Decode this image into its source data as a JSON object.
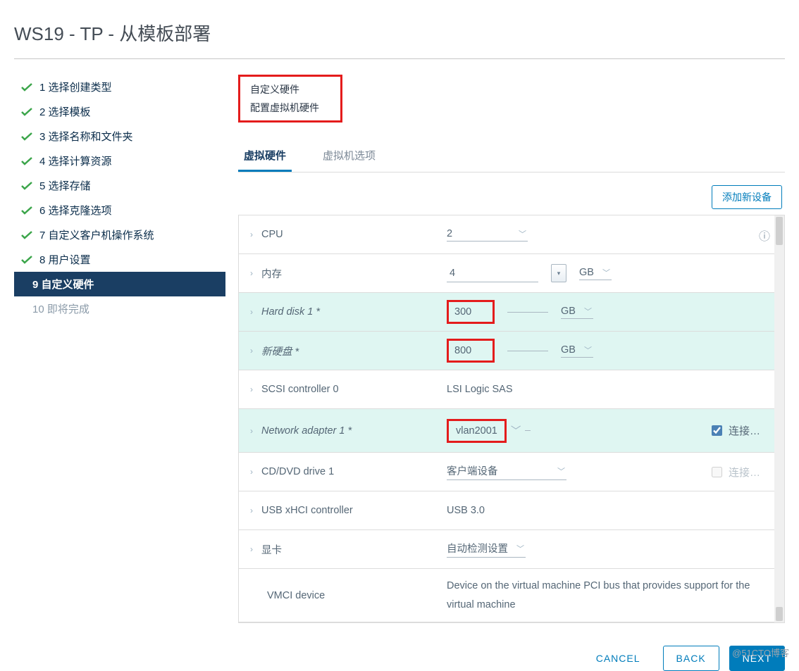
{
  "title": "WS19 - TP - 从模板部署",
  "sidebar": {
    "steps": [
      {
        "label": "1 选择创建类型"
      },
      {
        "label": "2 选择模板"
      },
      {
        "label": "3 选择名称和文件夹"
      },
      {
        "label": "4 选择计算资源"
      },
      {
        "label": "5 选择存储"
      },
      {
        "label": "6 选择克隆选项"
      },
      {
        "label": "7 自定义客户机操作系统"
      },
      {
        "label": "8 用户设置"
      }
    ],
    "active": "9 自定义硬件",
    "disabled": "10 即将完成"
  },
  "header": {
    "title": "自定义硬件",
    "subtitle": "配置虚拟机硬件"
  },
  "tabs": {
    "active": "虚拟硬件",
    "other": "虚拟机选项"
  },
  "add_device": "添加新设备",
  "hw": {
    "cpu": {
      "label": "CPU",
      "value": "2"
    },
    "mem": {
      "label": "内存",
      "value": "4",
      "unit": "GB"
    },
    "hd1": {
      "label": "Hard disk 1 *",
      "value": "300",
      "unit": "GB"
    },
    "hd2": {
      "label": "新硬盘 *",
      "value": "800",
      "unit": "GB"
    },
    "scsi": {
      "label": "SCSI controller 0",
      "value": "LSI Logic SAS"
    },
    "net": {
      "label": "Network adapter 1 *",
      "value": "vlan2001",
      "connect": "连接…"
    },
    "cd": {
      "label": "CD/DVD drive 1",
      "value": "客户端设备",
      "connect": "连接…"
    },
    "usb": {
      "label": "USB xHCI controller",
      "value": "USB 3.0"
    },
    "gpu": {
      "label": "显卡",
      "value": "自动检测设置"
    },
    "vmci": {
      "label": "VMCI device",
      "value": "Device on the virtual machine PCI bus that provides support for the virtual machine"
    }
  },
  "footer": {
    "cancel": "CANCEL",
    "back": "BACK",
    "next": "NEXT"
  },
  "watermark": "@51CTO博客"
}
